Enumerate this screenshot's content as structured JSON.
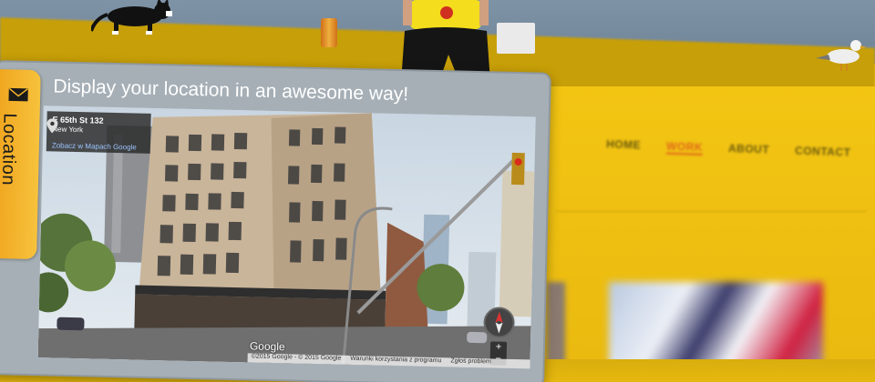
{
  "widget": {
    "tab_label": "Location",
    "tab_icon": "envelope-icon",
    "headline": "Display your location in an awesome way!"
  },
  "map": {
    "street": "E 65th St 132",
    "city": "New York",
    "link": "Zobacz w Mapach Google",
    "pin_icon": "map-pin-icon",
    "logo": "Google",
    "zoom_in": "+",
    "zoom_out": "−",
    "footer": {
      "copyright": "©2015 Google - © 2015 Google",
      "terms": "Warunki korzystania z programu",
      "report": "Zgłoś problem"
    }
  },
  "site_nav": {
    "items": [
      "HOME",
      "WORK",
      "ABOUT",
      "CONTACT"
    ],
    "active": "WORK"
  },
  "colors": {
    "site_yellow": "#f5c518",
    "tab_orange": "#f7b52b",
    "nav_active": "#e0681a",
    "panel_gray": "#a6afb6"
  }
}
